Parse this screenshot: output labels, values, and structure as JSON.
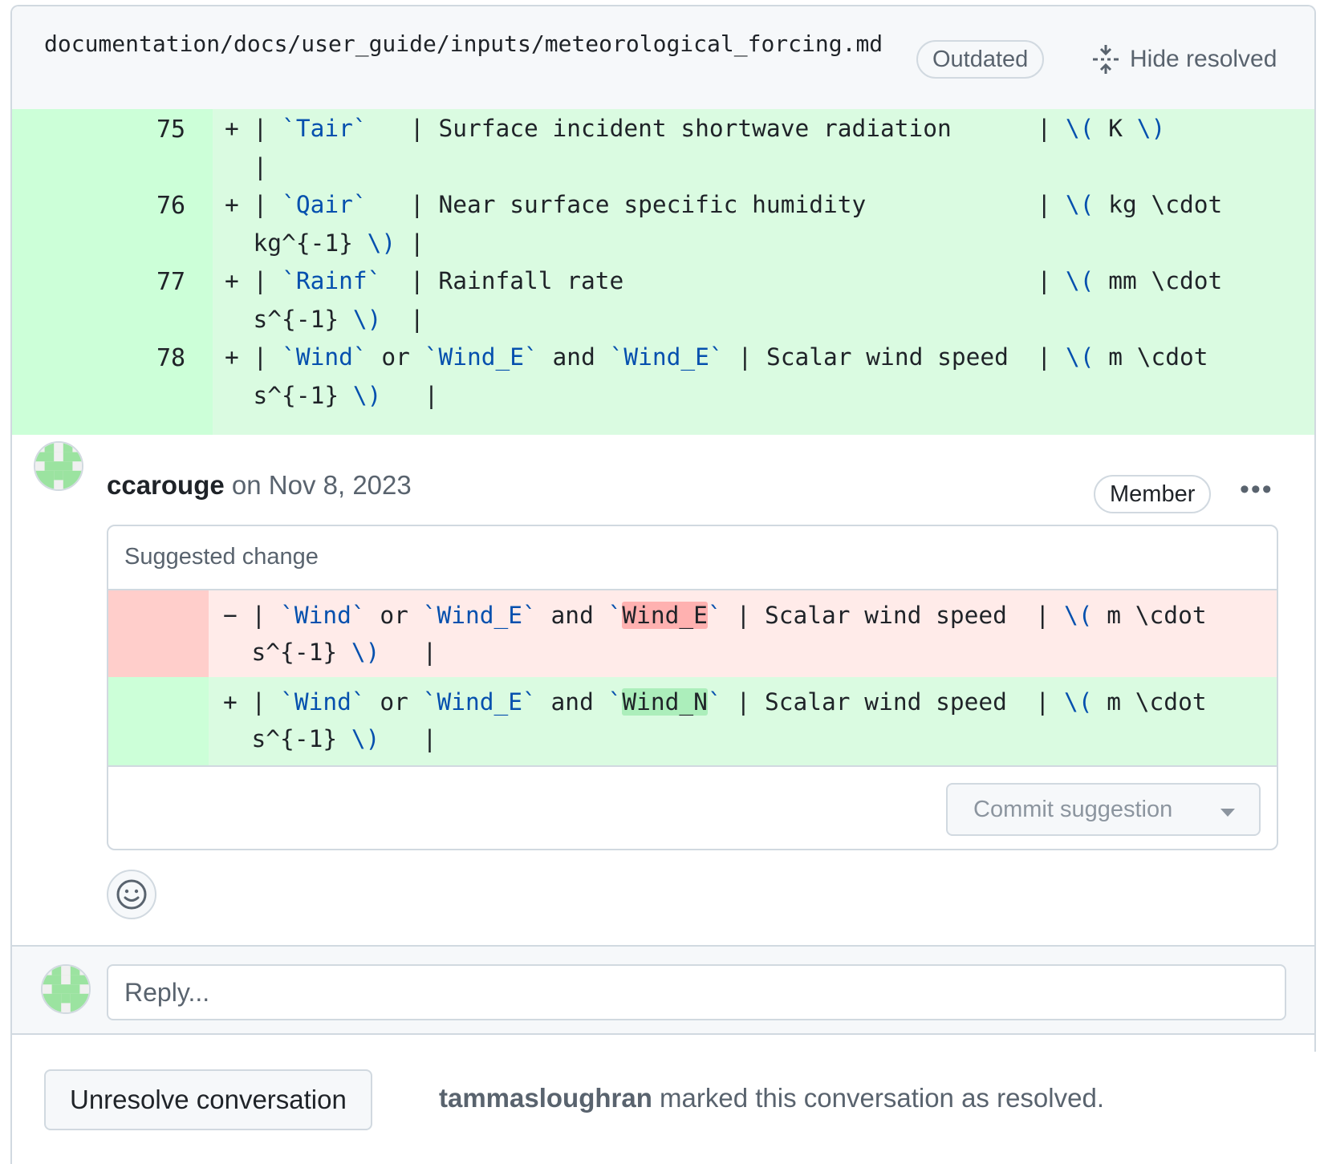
{
  "file": {
    "path": "documentation/docs/user_guide/inputs/meteorological_forcing.md",
    "status_badge": "Outdated",
    "hide_resolved_label": "Hide resolved"
  },
  "diff_context": [
    {
      "line": "75",
      "sign": "+",
      "parts": [
        [
          "| ",
          ""
        ],
        [
          "`Tair`",
          "tk"
        ],
        [
          "   | Surface incident shortwave radiation      | ",
          ""
        ],
        [
          "\\(",
          "tk"
        ],
        [
          " K ",
          ""
        ],
        [
          "\\)",
          "tk"
        ]
      ],
      "cont": [
        [
          "|",
          ""
        ]
      ]
    },
    {
      "line": "76",
      "sign": "+",
      "parts": [
        [
          "| ",
          ""
        ],
        [
          "`Qair`",
          "tk"
        ],
        [
          "   | Near surface specific humidity            | ",
          ""
        ],
        [
          "\\(",
          "tk"
        ],
        [
          " kg \\cdot",
          ""
        ]
      ],
      "cont": [
        [
          "kg^{-1} ",
          ""
        ],
        [
          "\\)",
          "tk"
        ],
        [
          " |",
          ""
        ]
      ]
    },
    {
      "line": "77",
      "sign": "+",
      "parts": [
        [
          "| ",
          ""
        ],
        [
          "`Rainf`",
          "tk"
        ],
        [
          "  | Rainfall rate                             | ",
          ""
        ],
        [
          "\\(",
          "tk"
        ],
        [
          " mm \\cdot",
          ""
        ]
      ],
      "cont": [
        [
          "s^{-1} ",
          ""
        ],
        [
          "\\)",
          "tk"
        ],
        [
          "  |",
          ""
        ]
      ]
    },
    {
      "line": "78",
      "sign": "+",
      "parts": [
        [
          "| ",
          ""
        ],
        [
          "`Wind`",
          "tk"
        ],
        [
          " or ",
          ""
        ],
        [
          "`Wind_E`",
          "tk"
        ],
        [
          " and ",
          ""
        ],
        [
          "`Wind_E`",
          "tk"
        ],
        [
          " | Scalar wind speed  | ",
          ""
        ],
        [
          "\\(",
          "tk"
        ],
        [
          " m \\cdot",
          ""
        ]
      ],
      "cont": [
        [
          "s^{-1} ",
          ""
        ],
        [
          "\\)",
          "tk"
        ],
        [
          "   |",
          ""
        ]
      ]
    }
  ],
  "comment": {
    "author": "ccarouge",
    "date": "on Nov 8, 2023",
    "role_badge": "Member",
    "more_label": "•••",
    "suggestion_label": "Suggested change",
    "deleted_line": {
      "sign": "−",
      "parts": [
        [
          "| ",
          ""
        ],
        [
          "`Wind`",
          "tk"
        ],
        [
          " or ",
          ""
        ],
        [
          "`Wind_E`",
          "tk"
        ],
        [
          " and ",
          ""
        ],
        [
          "`",
          "tk"
        ],
        [
          "Wind_E",
          "hl-del"
        ],
        [
          "`",
          "tk"
        ],
        [
          " | Scalar wind speed  | ",
          ""
        ],
        [
          "\\(",
          "tk"
        ],
        [
          " m \\cdot",
          ""
        ]
      ],
      "cont": [
        [
          "s^{-1} ",
          ""
        ],
        [
          "\\)",
          "tk"
        ],
        [
          "   |",
          ""
        ]
      ]
    },
    "added_line": {
      "sign": "+",
      "parts": [
        [
          "| ",
          ""
        ],
        [
          "`Wind`",
          "tk"
        ],
        [
          " or ",
          ""
        ],
        [
          "`Wind_E`",
          "tk"
        ],
        [
          " and ",
          ""
        ],
        [
          "`",
          "tk"
        ],
        [
          "Wind_N",
          "hl-add"
        ],
        [
          "`",
          "tk"
        ],
        [
          " | Scalar wind speed  | ",
          ""
        ],
        [
          "\\(",
          "tk"
        ],
        [
          " m \\cdot",
          ""
        ]
      ],
      "cont": [
        [
          "s^{-1} ",
          ""
        ],
        [
          "\\)",
          "tk"
        ],
        [
          "   |",
          ""
        ]
      ]
    },
    "commit_label": "Commit suggestion"
  },
  "reply": {
    "placeholder": "Reply..."
  },
  "resolution": {
    "button_label": "Unresolve conversation",
    "resolver": "tammasloughran",
    "message": " marked this conversation as resolved."
  },
  "colors": {
    "addition_bg": "#dafbe1",
    "deletion_bg": "#ffebe9",
    "token_blue": "#0550ae",
    "avatar_green": "#9be3a0"
  }
}
